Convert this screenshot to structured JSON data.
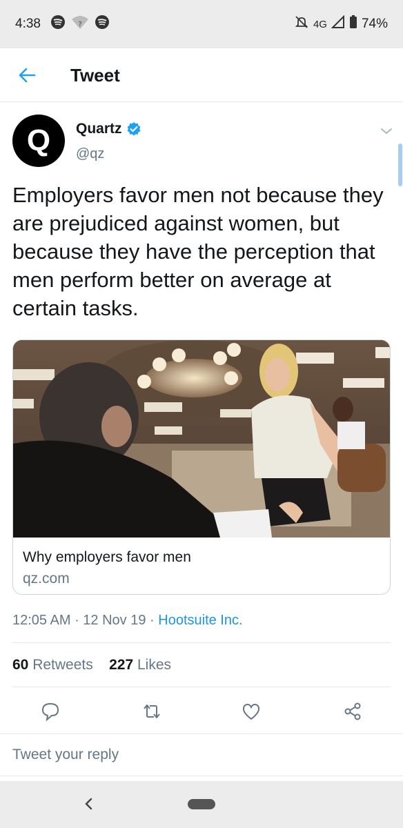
{
  "status_bar": {
    "time": "4:38",
    "network": "4G",
    "battery": "74%",
    "icons": [
      "spotify-icon",
      "wifi-icon",
      "spotify-icon",
      "mute-icon",
      "signal-icon",
      "battery-icon"
    ]
  },
  "header": {
    "title": "Tweet",
    "back_icon": "arrow-left-icon"
  },
  "tweet": {
    "author": {
      "avatar_letter": "Q",
      "name": "Quartz",
      "handle": "@qz",
      "verified": true
    },
    "text": "Employers favor men not because they are prejudiced against women, but because they have the perception that men perform better on average at certain tasks.",
    "card": {
      "title": "Why employers favor men",
      "domain": "qz.com"
    },
    "time": "12:05 AM",
    "date": "12 Nov 19",
    "source": "Hootsuite Inc.",
    "retweets_count": "60",
    "retweets_label": "Retweets",
    "likes_count": "227",
    "likes_label": "Likes"
  },
  "reply": {
    "placeholder": "Tweet your reply"
  },
  "colors": {
    "accent": "#1da1f2",
    "text": "#14171a",
    "secondary": "#657786",
    "border": "#e1e8ed"
  }
}
